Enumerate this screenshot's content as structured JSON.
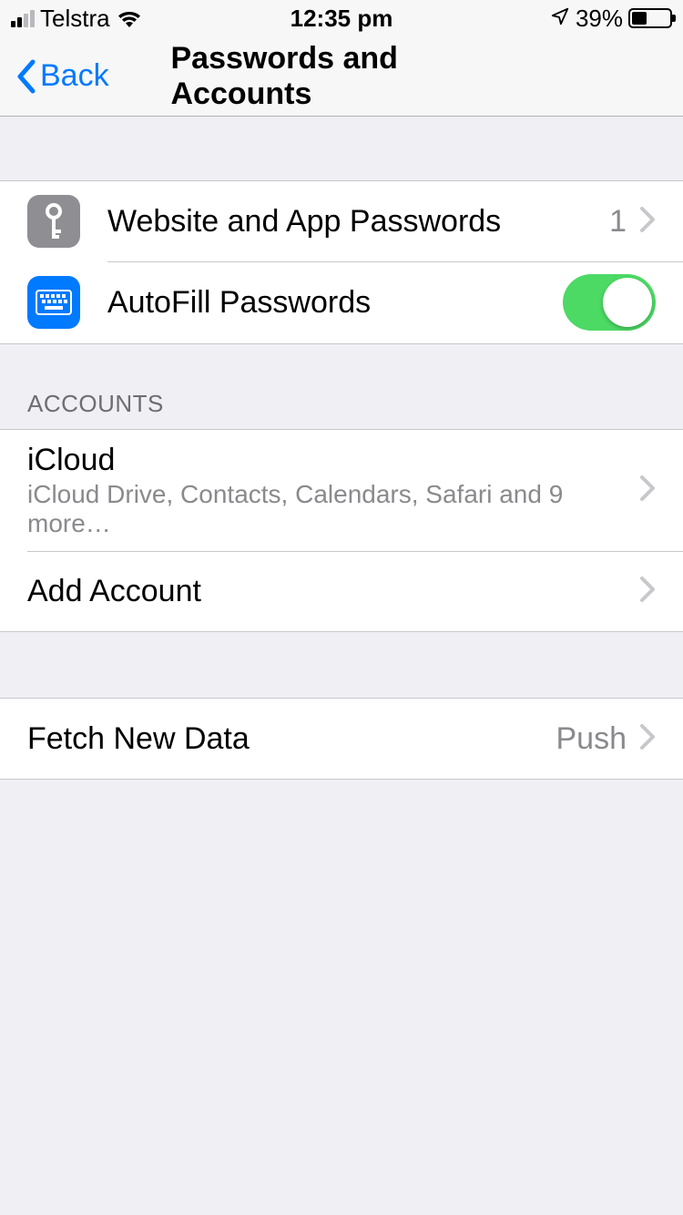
{
  "statusBar": {
    "carrier": "Telstra",
    "time": "12:35 pm",
    "batteryPercent": "39%"
  },
  "nav": {
    "backLabel": "Back",
    "title": "Passwords and Accounts"
  },
  "passwordsGroup": {
    "websitePasswords": {
      "label": "Website and App Passwords",
      "count": "1"
    },
    "autofill": {
      "label": "AutoFill Passwords",
      "enabled": true
    }
  },
  "accountsSection": {
    "header": "ACCOUNTS",
    "items": [
      {
        "title": "iCloud",
        "subtitle": "iCloud Drive, Contacts, Calendars, Safari and 9 more…"
      },
      {
        "title": "Add Account"
      }
    ]
  },
  "fetchSection": {
    "title": "Fetch New Data",
    "value": "Push"
  }
}
